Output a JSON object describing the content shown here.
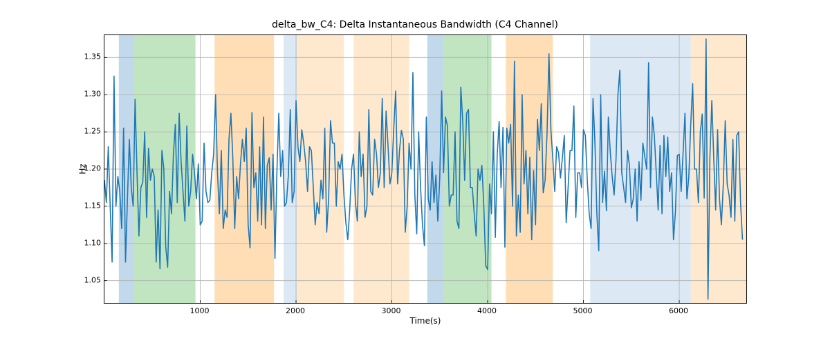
{
  "chart_data": {
    "type": "line",
    "title": "delta_bw_C4: Delta Instantaneous Bandwidth (C4 Channel)",
    "xlabel": "Time(s)",
    "ylabel": "Hz",
    "xlim": [
      0,
      6700
    ],
    "ylim": [
      1.02,
      1.38
    ],
    "x_ticks": [
      1000,
      2000,
      3000,
      4000,
      5000,
      6000
    ],
    "y_ticks": [
      1.05,
      1.1,
      1.15,
      1.2,
      1.25,
      1.3,
      1.35
    ],
    "y_tick_labels": [
      "1.05",
      "1.10",
      "1.15",
      "1.20",
      "1.25",
      "1.30",
      "1.35"
    ],
    "x_step": 20,
    "series": [
      {
        "name": "delta_bw_C4",
        "color": "#1f77b4",
        "values": [
          1.185,
          1.155,
          1.23,
          1.15,
          1.075,
          1.325,
          1.15,
          1.19,
          1.17,
          1.12,
          1.255,
          1.075,
          1.16,
          1.24,
          1.175,
          1.15,
          1.294,
          1.195,
          1.11,
          1.175,
          1.182,
          1.25,
          1.135,
          1.228,
          1.185,
          1.2,
          1.19,
          1.075,
          1.145,
          1.066,
          1.225,
          1.2,
          1.095,
          1.068,
          1.17,
          1.14,
          1.22,
          1.26,
          1.155,
          1.275,
          1.21,
          1.17,
          1.13,
          1.258,
          1.15,
          1.17,
          1.22,
          1.195,
          1.16,
          1.207,
          1.125,
          1.13,
          1.235,
          1.17,
          1.155,
          1.158,
          1.195,
          1.22,
          1.3,
          1.195,
          1.14,
          1.225,
          1.12,
          1.145,
          1.135,
          1.24,
          1.275,
          1.215,
          1.12,
          1.19,
          1.16,
          1.207,
          1.24,
          1.21,
          1.255,
          1.125,
          1.094,
          1.276,
          1.175,
          1.195,
          1.13,
          1.23,
          1.125,
          1.27,
          1.12,
          1.205,
          1.215,
          1.145,
          1.22,
          1.08,
          1.195,
          1.275,
          1.19,
          1.225,
          1.15,
          1.155,
          1.192,
          1.28,
          1.155,
          1.17,
          1.292,
          1.23,
          1.21,
          1.253,
          1.235,
          1.21,
          1.17,
          1.23,
          1.225,
          1.175,
          1.125,
          1.155,
          1.14,
          1.185,
          1.16,
          1.255,
          1.115,
          1.16,
          1.265,
          1.235,
          1.235,
          1.15,
          1.21,
          1.2,
          1.22,
          1.165,
          1.128,
          1.105,
          1.145,
          1.2,
          1.22,
          1.155,
          1.13,
          1.25,
          1.19,
          1.22,
          1.135,
          1.15,
          1.28,
          1.17,
          1.165,
          1.24,
          1.22,
          1.175,
          1.195,
          1.295,
          1.175,
          1.278,
          1.232,
          1.18,
          1.195,
          1.255,
          1.305,
          1.18,
          1.225,
          1.252,
          1.24,
          1.115,
          1.15,
          1.235,
          1.2,
          1.33,
          1.165,
          1.113,
          1.25,
          1.175,
          1.125,
          1.097,
          1.27,
          1.16,
          1.145,
          1.21,
          1.155,
          1.192,
          1.13,
          1.188,
          1.305,
          1.195,
          1.27,
          1.258,
          1.15,
          1.165,
          1.165,
          1.25,
          1.13,
          1.12,
          1.31,
          1.265,
          1.185,
          1.275,
          1.28,
          1.175,
          1.175,
          1.14,
          1.11,
          1.2,
          1.185,
          1.205,
          1.15,
          1.07,
          1.065,
          1.18,
          1.14,
          1.25,
          1.108,
          1.22,
          1.264,
          1.175,
          1.256,
          1.095,
          1.255,
          1.235,
          1.26,
          1.15,
          1.345,
          1.11,
          1.165,
          1.115,
          1.3,
          1.18,
          1.225,
          1.14,
          1.216,
          1.105,
          1.198,
          1.125,
          1.267,
          1.225,
          1.288,
          1.168,
          1.185,
          1.248,
          1.355,
          1.253,
          1.215,
          1.17,
          1.23,
          1.222,
          1.188,
          1.215,
          1.245,
          1.128,
          1.175,
          1.225,
          1.225,
          1.285,
          1.135,
          1.195,
          1.195,
          1.175,
          1.253,
          1.245,
          1.185,
          1.14,
          1.12,
          1.295,
          1.235,
          1.14,
          1.09,
          1.3,
          1.155,
          1.197,
          1.144,
          1.27,
          1.223,
          1.19,
          1.165,
          1.213,
          1.3,
          1.333,
          1.195,
          1.175,
          1.155,
          1.225,
          1.205,
          1.148,
          1.16,
          1.2,
          1.13,
          1.21,
          1.158,
          1.235,
          1.217,
          1.2,
          1.343,
          1.175,
          1.27,
          1.245,
          1.195,
          1.145,
          1.232,
          1.14,
          1.245,
          1.19,
          1.243,
          1.17,
          1.195,
          1.105,
          1.142,
          1.218,
          1.22,
          1.17,
          1.222,
          1.275,
          1.16,
          1.19,
          1.26,
          1.315,
          1.2,
          1.2,
          1.155,
          1.25,
          1.274,
          1.161,
          1.375,
          1.025,
          1.215,
          1.292,
          1.215,
          1.145,
          1.253,
          1.16,
          1.125,
          1.18,
          1.265,
          1.18,
          1.165,
          1.135,
          1.24,
          1.13,
          1.245,
          1.25,
          1.155,
          1.105
        ]
      }
    ],
    "bands": [
      {
        "color": "#8fb8da",
        "alpha": 0.55,
        "x0": 150,
        "x1": 310
      },
      {
        "color": "#8ecf8e",
        "alpha": 0.55,
        "x0": 310,
        "x1": 950
      },
      {
        "color": "#ffc27a",
        "alpha": 0.55,
        "x0": 1150,
        "x1": 1770
      },
      {
        "color": "#cddff0",
        "alpha": 0.7,
        "x0": 1870,
        "x1": 2010
      },
      {
        "color": "#ffe4c2",
        "alpha": 0.8,
        "x0": 2010,
        "x1": 2500
      },
      {
        "color": "#ffe4c2",
        "alpha": 0.8,
        "x0": 2600,
        "x1": 3180
      },
      {
        "color": "#8fb8da",
        "alpha": 0.55,
        "x0": 3370,
        "x1": 3540
      },
      {
        "color": "#8ecf8e",
        "alpha": 0.55,
        "x0": 3540,
        "x1": 4040
      },
      {
        "color": "#ffc27a",
        "alpha": 0.55,
        "x0": 4190,
        "x1": 4680
      },
      {
        "color": "#cddff0",
        "alpha": 0.7,
        "x0": 5070,
        "x1": 6120
      },
      {
        "color": "#ffe4c2",
        "alpha": 0.8,
        "x0": 6120,
        "x1": 6700
      }
    ]
  }
}
